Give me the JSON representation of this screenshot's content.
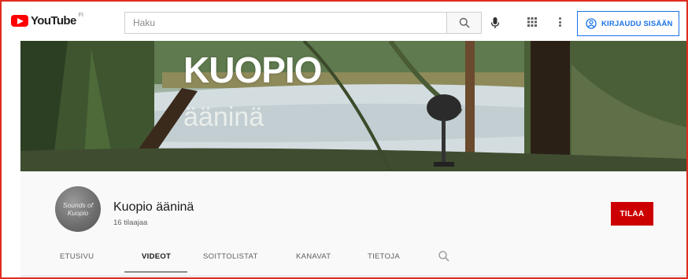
{
  "header": {
    "logo_text": "YouTube",
    "logo_country": "FI",
    "search": {
      "placeholder": "Haku",
      "value": ""
    },
    "icons": [
      "search-icon",
      "microphone-icon",
      "apps-grid-icon",
      "more-vertical-icon",
      "account-circle-icon"
    ],
    "signin_label": "KIRJAUDU SISÄÄN"
  },
  "banner": {
    "title": "KUOPIO",
    "subtitle": "ääninä"
  },
  "channel": {
    "name": "Kuopio ääninä",
    "subscribers": "16 tilaajaa",
    "avatar_text": "Sounds of Kuopio",
    "subscribe_label": "TILAA"
  },
  "tabs": [
    {
      "label": "ETUSIVU",
      "active": false
    },
    {
      "label": "VIDEOT",
      "active": true
    },
    {
      "label": "SOITTOLISTAT",
      "active": false
    },
    {
      "label": "KANAVAT",
      "active": false
    },
    {
      "label": "TIETOJA",
      "active": false
    }
  ],
  "colors": {
    "brand_red": "#ff0000",
    "subscribe_red": "#cc0000",
    "signin_blue": "#1a73e8",
    "frame_red": "#e02b20"
  }
}
